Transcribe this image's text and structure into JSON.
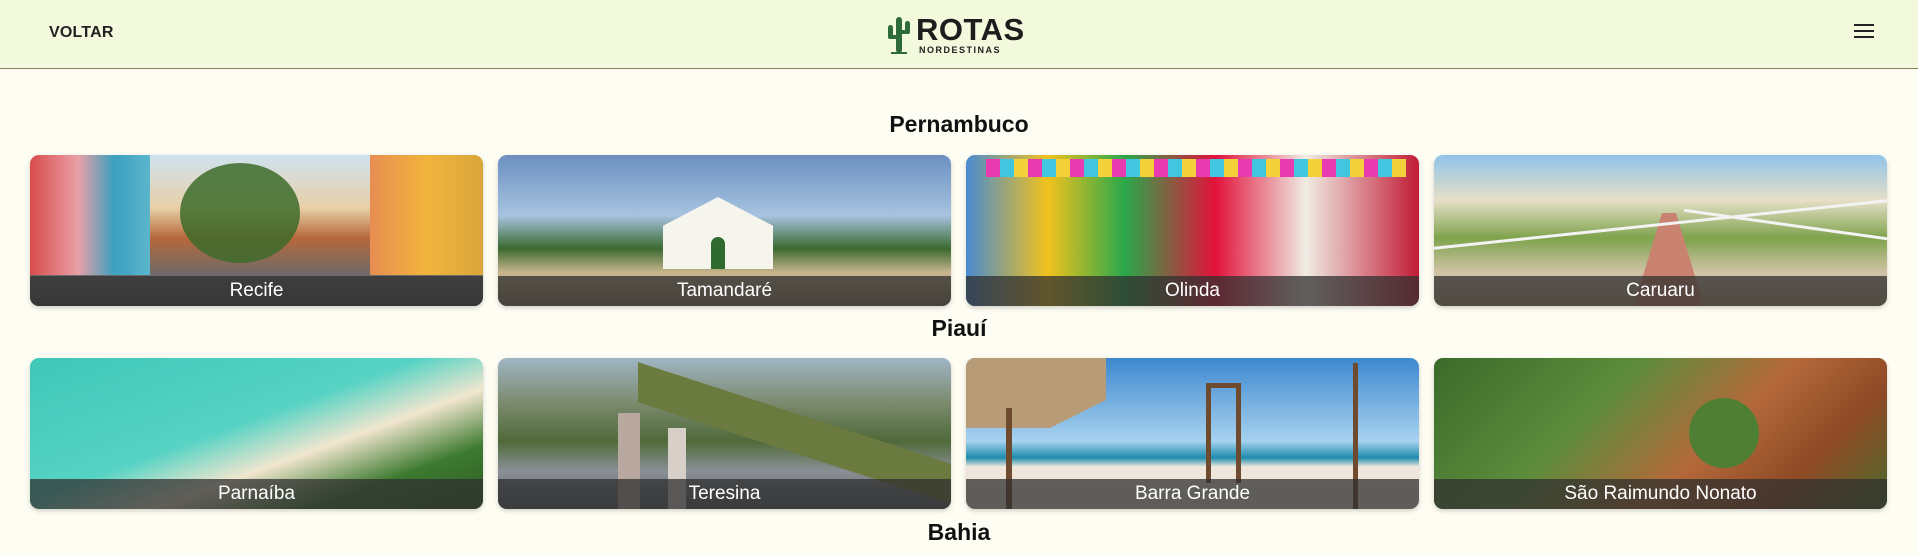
{
  "header": {
    "back_label": "VOLTAR",
    "logo_title": "ROTAS",
    "logo_subtitle": "NORDESTINAS"
  },
  "sections": [
    {
      "title": "Pernambuco",
      "cities": [
        "Recife",
        "Tamandaré",
        "Olinda",
        "Caruaru"
      ]
    },
    {
      "title": "Piauí",
      "cities": [
        "Parnaíba",
        "Teresina",
        "Barra Grande",
        "São Raimundo Nonato"
      ]
    },
    {
      "title": "Bahia"
    }
  ],
  "icons": {
    "logo": "cactus-icon",
    "menu": "hamburger-menu-icon"
  },
  "colors": {
    "header_bg": "#f3f9dc",
    "page_bg": "#fdfdf3",
    "label_overlay": "#303030",
    "cactus": "#2f6b3a"
  }
}
